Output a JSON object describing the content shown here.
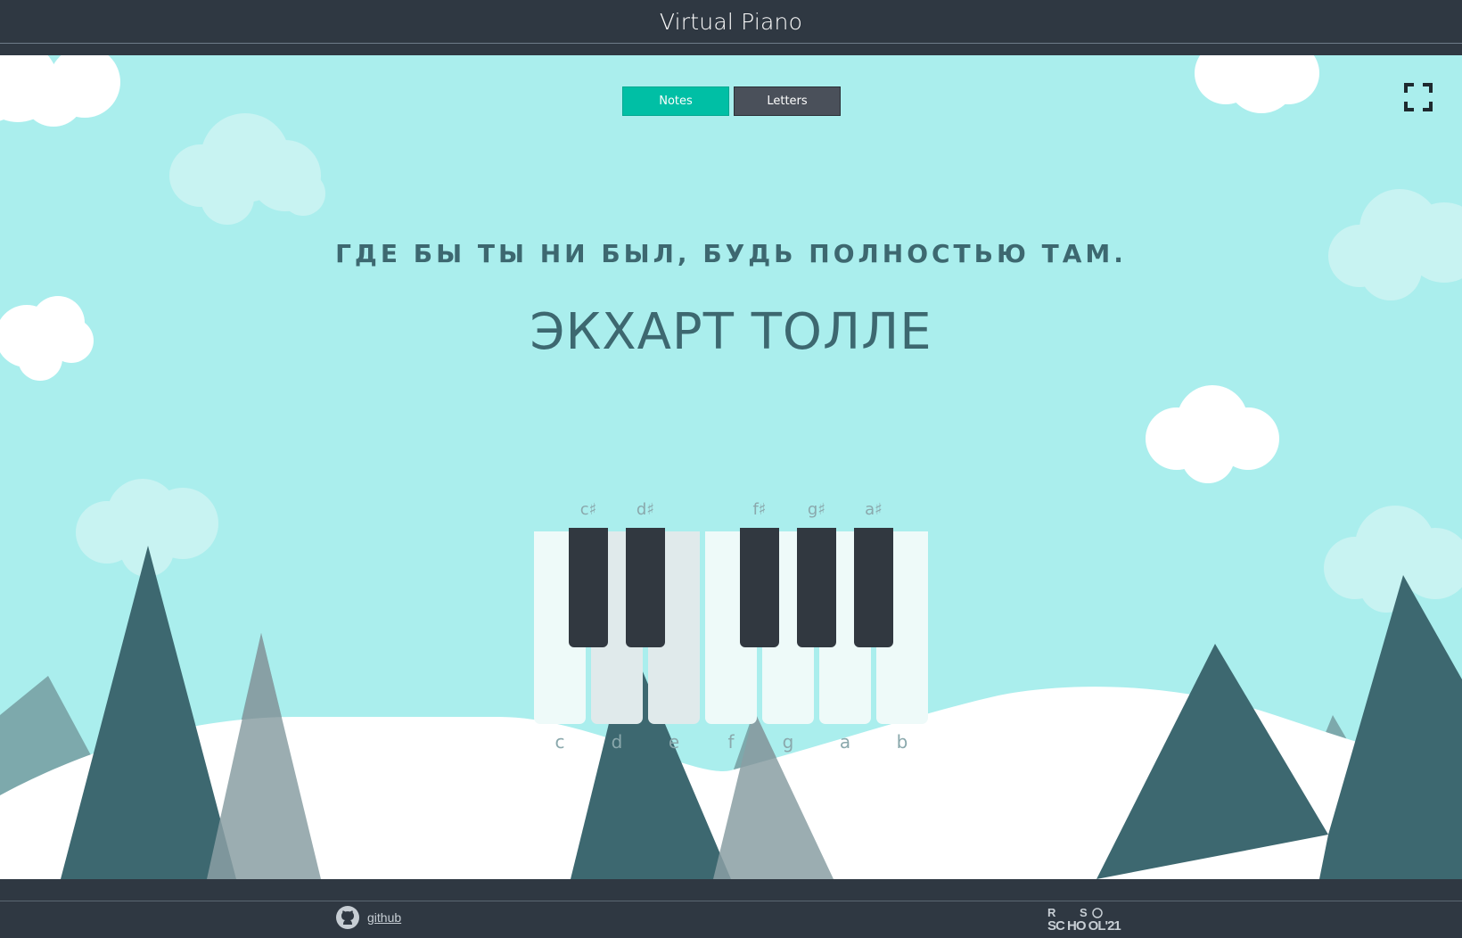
{
  "header": {
    "title": "Virtual Piano"
  },
  "toggle": {
    "notes_label": "Notes",
    "letters_label": "Letters",
    "active": "Notes",
    "active_color": "#00bfa5",
    "inactive_color": "#4a505a"
  },
  "fullscreen": {
    "icon": "fullscreen-icon"
  },
  "quote": {
    "text": "ГДЕ БЫ ТЫ НИ БЫЛ, БУДЬ ПОЛНОСТЬЮ ТАМ.",
    "author": "ЭКХАРТ ТОЛЛЕ"
  },
  "piano": {
    "white_keys": [
      {
        "note": "c"
      },
      {
        "note": "d"
      },
      {
        "note": "e"
      },
      {
        "note": "f"
      },
      {
        "note": "g"
      },
      {
        "note": "a"
      },
      {
        "note": "b"
      }
    ],
    "black_keys": [
      {
        "note": "c♯"
      },
      {
        "note": "d♯"
      },
      {
        "note": "f♯"
      },
      {
        "note": "g♯"
      },
      {
        "note": "a♯"
      }
    ]
  },
  "footer": {
    "github_label": "github",
    "github_icon": "github-icon",
    "school_logo": {
      "line1_left": "R",
      "line1_right": "S",
      "line2": "SC HO OL'21"
    }
  },
  "colors": {
    "sky": "#aaeeed",
    "chrome": "#2f3842",
    "mountain": "#3d6870",
    "text": "#3d6870"
  }
}
